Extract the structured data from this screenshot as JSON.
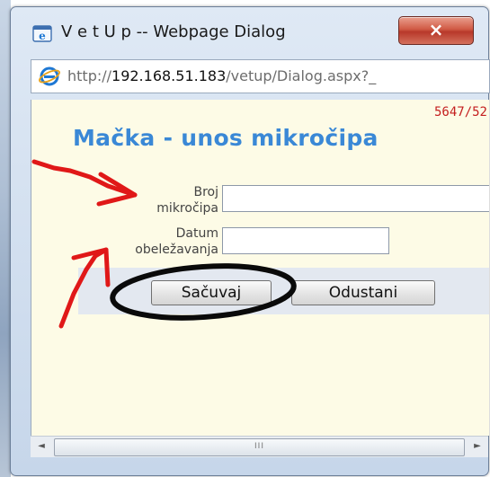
{
  "window": {
    "title": "V e t U p -- Webpage Dialog",
    "close_symbol": "×"
  },
  "address": {
    "url_prefix": "http://",
    "url_host": "192.168.51.183",
    "url_path": "/vetup/Dialog.aspx?_"
  },
  "form": {
    "record_id": "5647/52",
    "title": "Mačka - unos mikročipa",
    "broj_label_line1": "Broj",
    "broj_label_line2": "mikročipa",
    "datum_label_line1": "Datum",
    "datum_label_line2": "obeležavanja",
    "broj_value": "",
    "datum_value": "",
    "save_label": "Sačuvaj",
    "cancel_label": "Odustani"
  },
  "scrollbar": {
    "left_arrow": "◄",
    "right_arrow": "►",
    "grip": "III"
  },
  "icons": {
    "window_icon": "internet-explorer-icon",
    "address_icon": "internet-explorer-icon",
    "annotation": "red-arrows-and-black-circle"
  },
  "colors": {
    "title_blue": "#3a88d6",
    "record_red": "#c41e1e",
    "content_bg": "#fdfbe6",
    "annotation_red": "#e01818"
  }
}
